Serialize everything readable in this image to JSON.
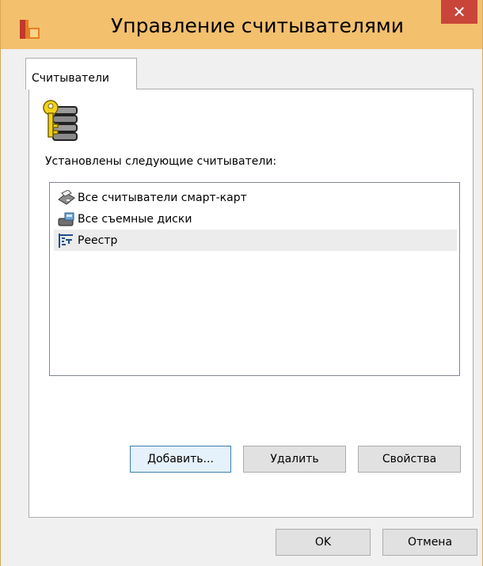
{
  "window": {
    "title": "Управление считывателями",
    "close_glyph": "✕",
    "app_icon": "app-icon"
  },
  "tabs": [
    {
      "label": "Считыватели",
      "active": true
    }
  ],
  "panel": {
    "icon": "key-readers-icon",
    "installed_label": "Установлены следующие считыватели:",
    "readers": [
      {
        "label": "Все считыватели смарт-карт",
        "icon": "smartcard-reader-icon",
        "selected": false
      },
      {
        "label": "Все съемные диски",
        "icon": "removable-disk-icon",
        "selected": false
      },
      {
        "label": "Реестр",
        "icon": "registry-icon",
        "selected": true
      }
    ],
    "buttons": {
      "add": "Добавить...",
      "remove": "Удалить",
      "properties": "Свойства"
    }
  },
  "footer": {
    "ok": "OK",
    "cancel": "Отмена"
  },
  "colors": {
    "titlebar": "#f3c06e",
    "close": "#c9453a",
    "selection": "#ececec"
  }
}
